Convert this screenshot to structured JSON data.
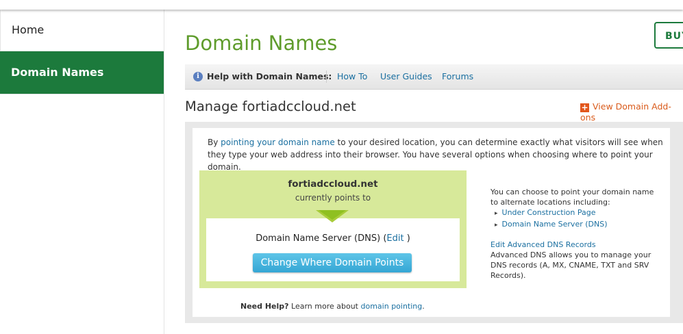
{
  "sidebar": {
    "items": [
      {
        "label": "Home",
        "active": false
      },
      {
        "label": "Domain Names",
        "active": true
      }
    ]
  },
  "main": {
    "title": "Domain Names",
    "buy_label": "BUY",
    "helpbar": {
      "icon": "info-icon",
      "label": "Help with Domain Names:",
      "links": [
        "How To",
        "User Guides",
        "Forums"
      ]
    },
    "manage_title": "Manage fortiadccloud.net",
    "addons_link": "View Domain Add-ons",
    "intro": {
      "before": "By ",
      "link": "pointing your domain name",
      "after": " to your desired location, you can determine exactly what visitors will see when they type your web address into their browser. You have several options when choosing where to point your domain."
    },
    "pointing": {
      "domain": "fortiadccloud.net",
      "sub": "currently points to",
      "target": "Domain Name Server (DNS)",
      "edit_open": "(",
      "edit_label": "Edit",
      "edit_close": " )",
      "button": "Change Where Domain Points"
    },
    "needhelp": {
      "bold": "Need Help?",
      "text": " Learn more about ",
      "link": "domain pointing",
      "end": "."
    },
    "side": {
      "intro": "You can choose to point your domain name to alternate locations including:",
      "options": [
        "Under Construction Page",
        "Domain Name Server (DNS)"
      ],
      "adv_link": "Edit Advanced DNS Records",
      "adv_text": "Advanced DNS allows you to manage your DNS records (A, MX, CNAME, TXT and SRV Records)."
    }
  },
  "colors": {
    "brand_green": "#1c7a3c",
    "title_green": "#5f9c2c",
    "link_blue": "#1a6fa0",
    "addon_orange": "#e2561b",
    "panel_green": "#d7e99a",
    "button_blue": "#35a6d4"
  }
}
